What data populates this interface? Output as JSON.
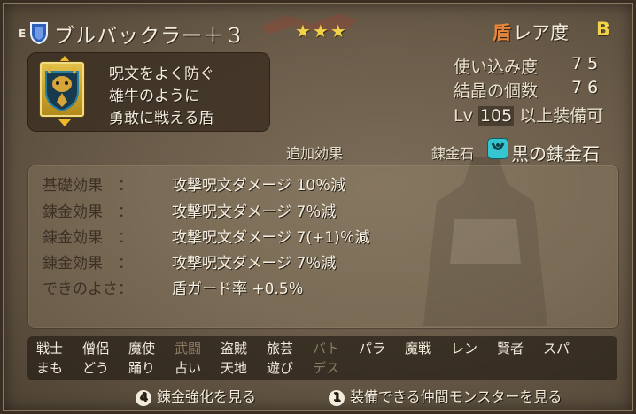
{
  "item": {
    "equip_marker": "E",
    "name": "ブルバックラー＋３",
    "stars": "★★★",
    "rarity_icon": "盾",
    "rarity_label": "レア度",
    "rarity_grade": "B"
  },
  "description": {
    "lines": [
      "呪文をよく防ぐ",
      "雄牛のように",
      "勇敢に戦える盾"
    ]
  },
  "stats": {
    "usage_label": "使い込み度",
    "usage_value": "75",
    "crystals_label": "結晶の個数",
    "crystals_value": "76",
    "level_prefix": "Lv",
    "level_value": "105",
    "level_suffix": "以上装備可"
  },
  "sections": {
    "extra_effects_label": "追加効果",
    "alchemy_stone_label": "錬金石",
    "alchemy_stone_name": "黒の錬金石"
  },
  "effects": [
    {
      "label": "基礎効果　：",
      "value": "攻撃呪文ダメージ 10％減"
    },
    {
      "label": "錬金効果　：",
      "value": "攻撃呪文ダメージ 7％減"
    },
    {
      "label": "錬金効果　：",
      "value": "攻撃呪文ダメージ 7(+1)％減"
    },
    {
      "label": "錬金効果　：",
      "value": "攻撃呪文ダメージ 7％減"
    },
    {
      "label": "できのよさ：",
      "value": "盾ガード率 +0.5％"
    }
  ],
  "jobs": {
    "row1": [
      {
        "label": "戦士",
        "enabled": true
      },
      {
        "label": "僧侶",
        "enabled": true
      },
      {
        "label": "魔使",
        "enabled": true
      },
      {
        "label": "武闘",
        "enabled": false
      },
      {
        "label": "盗賊",
        "enabled": true
      },
      {
        "label": "旅芸",
        "enabled": true
      },
      {
        "label": "バト",
        "enabled": false
      },
      {
        "label": "パラ",
        "enabled": true
      },
      {
        "label": "魔戦",
        "enabled": true
      },
      {
        "label": "レン",
        "enabled": true
      },
      {
        "label": "賢者",
        "enabled": true
      },
      {
        "label": "スパ",
        "enabled": true
      }
    ],
    "row2": [
      {
        "label": "まも",
        "enabled": true
      },
      {
        "label": "どう",
        "enabled": true
      },
      {
        "label": "踊り",
        "enabled": true
      },
      {
        "label": "占い",
        "enabled": true
      },
      {
        "label": "天地",
        "enabled": true
      },
      {
        "label": "遊び",
        "enabled": true
      },
      {
        "label": "デス",
        "enabled": false
      }
    ]
  },
  "hints": [
    {
      "button": "4",
      "label": "錬金強化を見る"
    },
    {
      "button": "1",
      "label": "装備できる仲間モンスターを見る"
    }
  ],
  "colors": {
    "panel": "#6b5d4a",
    "star": "#f1d34a",
    "rarity_icon": "#e6863a",
    "alchemy_stone": "#36c6d2",
    "dim_job": "#8a7b63"
  },
  "icons": {
    "item": "shield-icon",
    "slot": "small-shield-icon",
    "alchemy": "alchemy-stone-icon"
  }
}
